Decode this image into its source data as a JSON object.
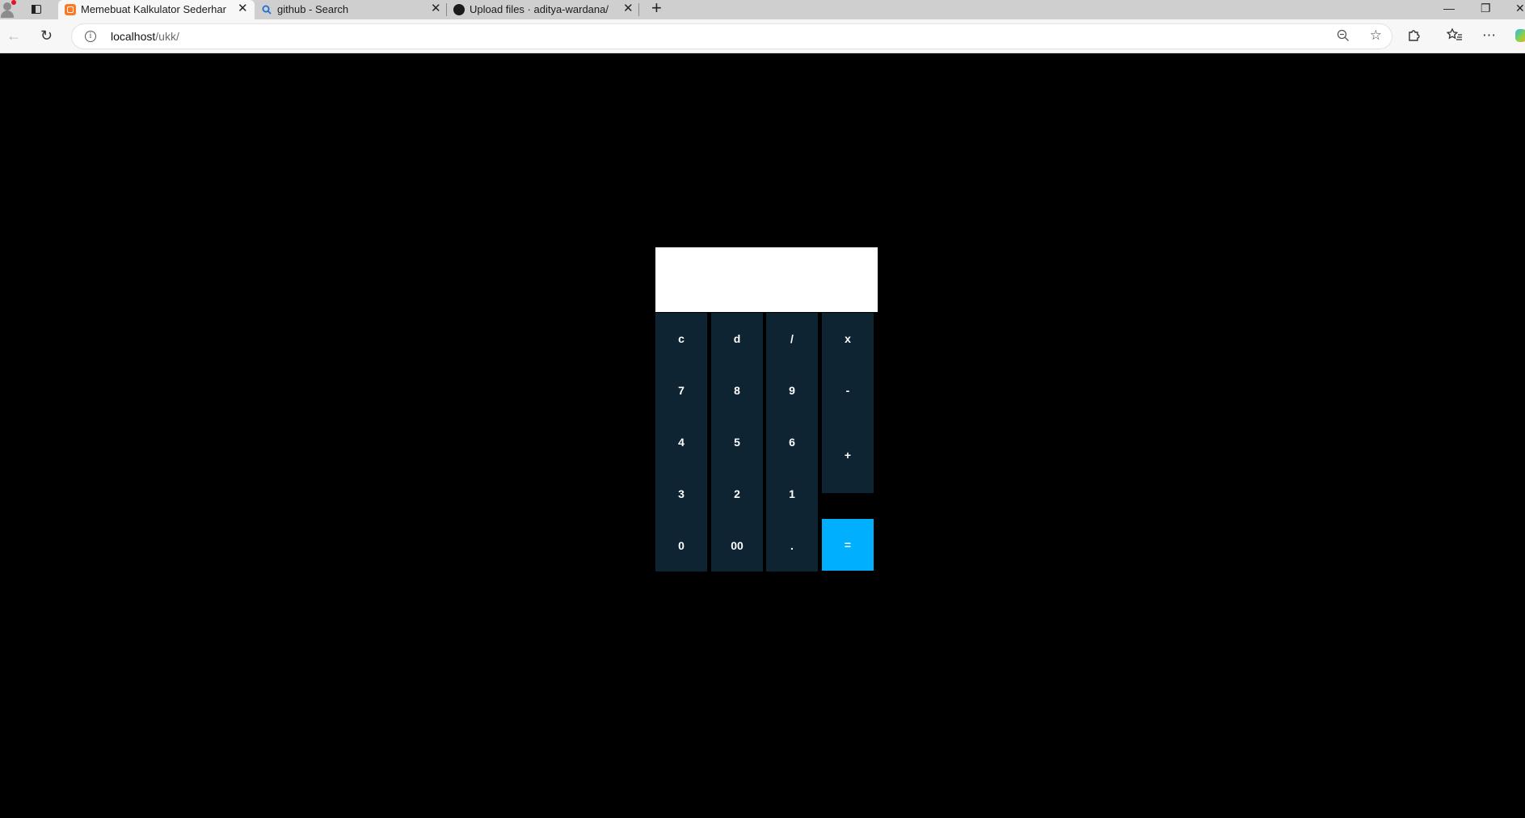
{
  "browser": {
    "tabs": [
      {
        "title": "Memebuat Kalkulator Sederhana",
        "favicon": "xampp-icon",
        "active": true
      },
      {
        "title": "github - Search",
        "favicon": "search-icon",
        "active": false
      },
      {
        "title": "Upload files · aditya-wardana/UKK",
        "favicon": "github-icon",
        "active": false
      }
    ],
    "close_glyph": "✕",
    "new_tab_glyph": "+",
    "address": {
      "host": "localhost",
      "path": "/ukk/"
    },
    "window_controls": {
      "minimize": "—",
      "restore": "❐",
      "close": "✕"
    }
  },
  "calculator": {
    "display_value": "",
    "keys": {
      "clear": "c",
      "delete": "d",
      "divide": "/",
      "multiply": "x",
      "seven": "7",
      "eight": "8",
      "nine": "9",
      "minus": "-",
      "four": "4",
      "five": "5",
      "six": "6",
      "plus": "+",
      "three": "3",
      "two": "2",
      "one": "1",
      "zero": "0",
      "double_zero": "00",
      "decimal": ".",
      "equals": "="
    },
    "colors": {
      "page_background": "#000000",
      "key": "#0e2433",
      "equals": "#00b0ff",
      "display": "#ffffff"
    }
  }
}
